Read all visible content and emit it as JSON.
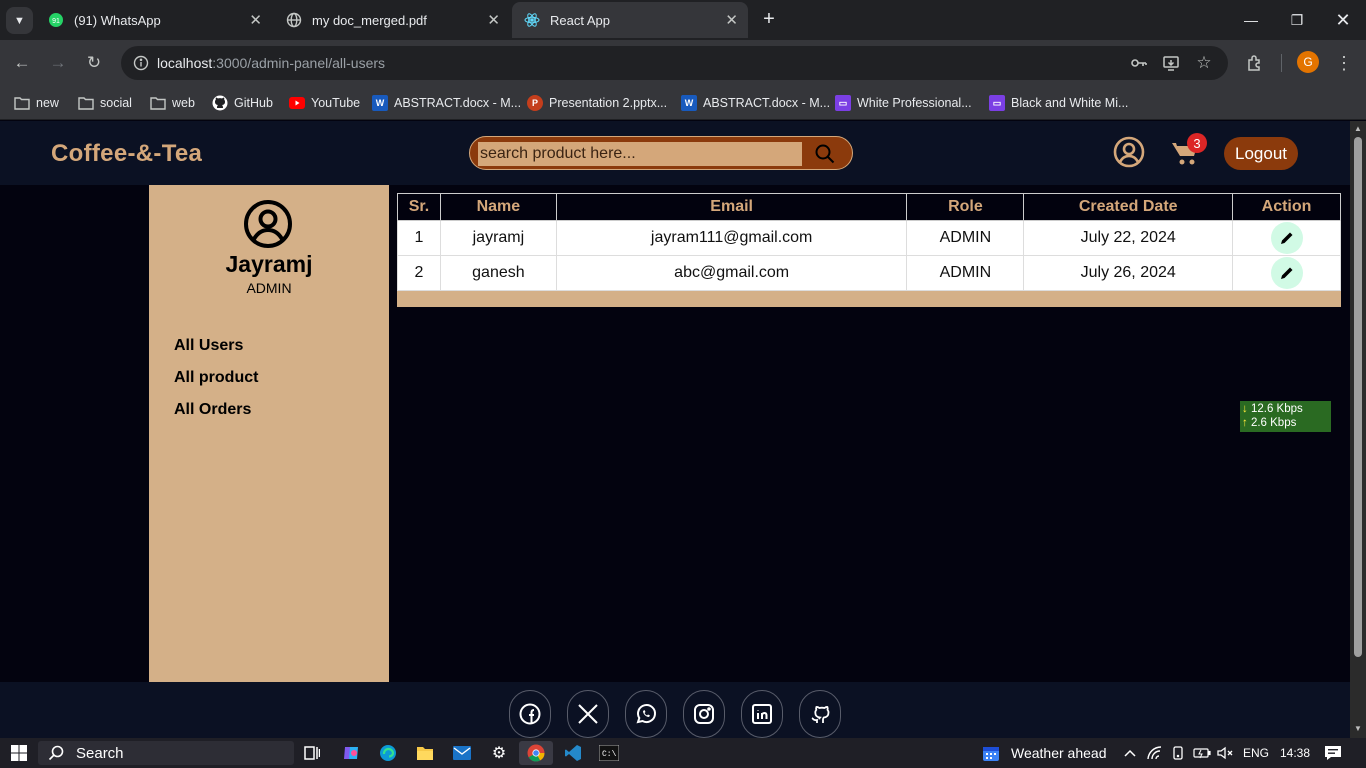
{
  "browser": {
    "tabs": [
      {
        "title": "(91) WhatsApp",
        "icon": "whatsapp-icon"
      },
      {
        "title": "my doc_merged.pdf",
        "icon": "globe-icon"
      },
      {
        "title": "React App",
        "icon": "react-icon",
        "active": true
      }
    ],
    "url_host": "localhost",
    "url_path": ":3000/admin-panel/all-users",
    "profile_initial": "G",
    "bookmarks": [
      {
        "label": "new",
        "icon": "folder-icon"
      },
      {
        "label": "social",
        "icon": "folder-icon"
      },
      {
        "label": "web",
        "icon": "folder-icon"
      },
      {
        "label": "GitHub",
        "icon": "github-icon"
      },
      {
        "label": "YouTube",
        "icon": "youtube-icon"
      },
      {
        "label": "ABSTRACT.docx - M...",
        "icon": "word-icon"
      },
      {
        "label": "Presentation 2.pptx...",
        "icon": "powerpoint-icon"
      },
      {
        "label": "ABSTRACT.docx - M...",
        "icon": "word-icon"
      },
      {
        "label": "White Professional...",
        "icon": "canva-icon"
      },
      {
        "label": "Black and White Mi...",
        "icon": "canva-icon"
      }
    ]
  },
  "app": {
    "logo": "Coffee-&-Tea",
    "search_placeholder": "search product here...",
    "cart_count": "3",
    "logout_label": "Logout",
    "colors": {
      "accent": "#d4a77a",
      "brand_dark": "#8b3a0c",
      "header_bg": "#0b1123",
      "page_bg": "#03030f"
    }
  },
  "sidebar": {
    "user_name": "Jayramj",
    "user_role": "ADMIN",
    "links": [
      "All Users",
      "All product",
      "All Orders"
    ]
  },
  "users_table": {
    "headers": [
      "Sr.",
      "Name",
      "Email",
      "Role",
      "Created Date",
      "Action"
    ],
    "rows": [
      {
        "sr": "1",
        "name": "jayramj",
        "email": "jayram111@gmail.com",
        "role": "ADMIN",
        "created": "July 22, 2024"
      },
      {
        "sr": "2",
        "name": "ganesh",
        "email": "abc@gmail.com",
        "role": "ADMIN",
        "created": "July 26, 2024"
      }
    ]
  },
  "net_speed": {
    "down": "12.6 Kbps",
    "up": "2.6 Kbps"
  },
  "footer": {
    "social": [
      "facebook-icon",
      "x-icon",
      "whatsapp-icon",
      "instagram-icon",
      "linkedin-icon",
      "github-icon"
    ]
  },
  "taskbar": {
    "search_label": "Search",
    "weather": "Weather ahead",
    "lang": "ENG",
    "time": "14:38"
  }
}
